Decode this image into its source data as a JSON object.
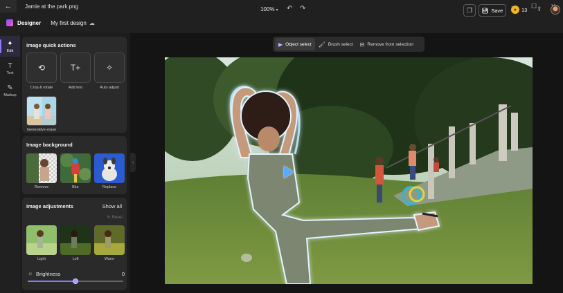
{
  "window": {
    "title": "Jamie at the park.png",
    "back_icon": "back-arrow-icon",
    "controls": [
      "minimize-icon",
      "maximize-icon",
      "close-icon"
    ]
  },
  "header": {
    "app_name": "Designer",
    "design_name": "My first design",
    "zoom": "100%",
    "save_label": "Save",
    "credits": "13"
  },
  "rail": {
    "items": [
      {
        "label": "Edit",
        "icon": "sparkle-edit-icon",
        "active": true
      },
      {
        "label": "Text",
        "icon": "text-icon",
        "active": false
      },
      {
        "label": "Markup",
        "icon": "pen-icon",
        "active": false
      }
    ]
  },
  "panel": {
    "quick_actions": {
      "title": "Image quick actions",
      "items": [
        {
          "label": "Crop & rotate",
          "icon": "crop-rotate-icon"
        },
        {
          "label": "Add text",
          "icon": "add-text-icon"
        },
        {
          "label": "Auto adjust",
          "icon": "magic-wand-icon"
        },
        {
          "label": "Generative erase",
          "icon": "generative-erase-thumbnail"
        }
      ]
    },
    "background": {
      "title": "Image background",
      "items": [
        {
          "label": "Remove"
        },
        {
          "label": "Blur"
        },
        {
          "label": "Replace"
        }
      ]
    },
    "adjustments": {
      "title": "Image adjustments",
      "show_all": "Show all",
      "reset": "Reset",
      "filters": [
        {
          "label": "Light"
        },
        {
          "label": "Lofi"
        },
        {
          "label": "Warm"
        }
      ],
      "brightness": {
        "label": "Brightness",
        "value": "0",
        "fraction": 0.5
      }
    }
  },
  "selection_toolbar": {
    "items": [
      {
        "label": "Object select",
        "icon": "object-select-icon",
        "active": true
      },
      {
        "label": "Brush select",
        "icon": "brush-icon",
        "active": false
      },
      {
        "label": "Remove from selection",
        "icon": "remove-selection-icon",
        "active": false
      }
    ]
  },
  "colors": {
    "accent": "#8b7cff",
    "background": "#1a1a1a",
    "panel": "#2a2a2a",
    "selection_glow": "#9fd3ff"
  }
}
